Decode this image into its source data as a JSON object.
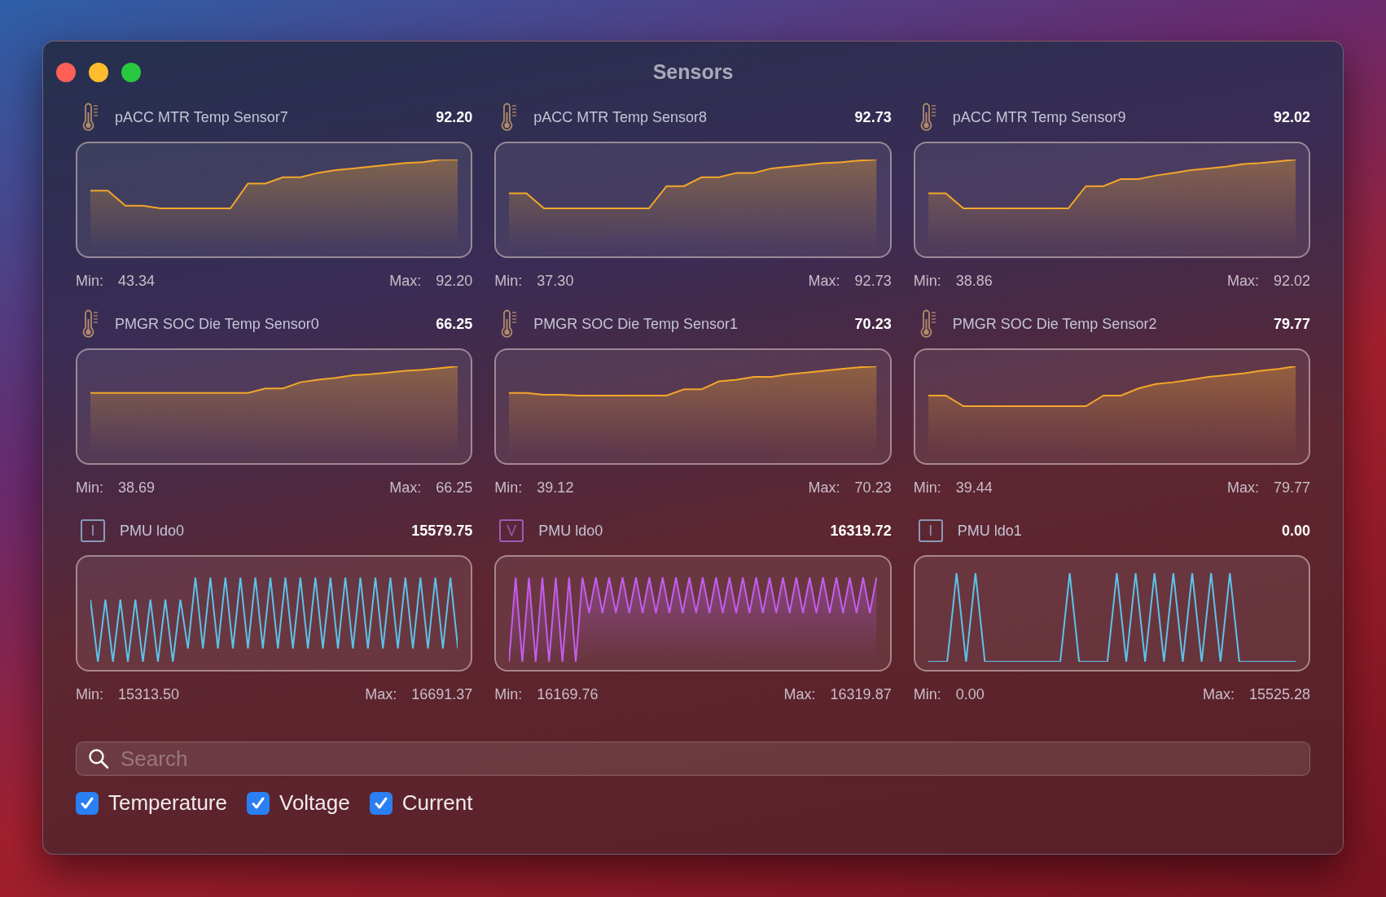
{
  "window": {
    "title": "Sensors"
  },
  "sensors": [
    {
      "kind": "temperature",
      "name": "pACC MTR Temp Sensor7",
      "value": "92.20",
      "min_label": "Min:",
      "min": "43.34",
      "max_label": "Max:",
      "max": "92.20"
    },
    {
      "kind": "temperature",
      "name": "pACC MTR Temp Sensor8",
      "value": "92.73",
      "min_label": "Min:",
      "min": "37.30",
      "max_label": "Max:",
      "max": "92.73"
    },
    {
      "kind": "temperature",
      "name": "pACC MTR Temp Sensor9",
      "value": "92.02",
      "min_label": "Min:",
      "min": "38.86",
      "max_label": "Max:",
      "max": "92.02"
    },
    {
      "kind": "temperature",
      "name": "PMGR SOC Die Temp Sensor0",
      "value": "66.25",
      "min_label": "Min:",
      "min": "38.69",
      "max_label": "Max:",
      "max": "66.25"
    },
    {
      "kind": "temperature",
      "name": "PMGR SOC Die Temp Sensor1",
      "value": "70.23",
      "min_label": "Min:",
      "min": "39.12",
      "max_label": "Max:",
      "max": "70.23"
    },
    {
      "kind": "temperature",
      "name": "PMGR SOC Die Temp Sensor2",
      "value": "79.77",
      "min_label": "Min:",
      "min": "39.44",
      "max_label": "Max:",
      "max": "79.77"
    },
    {
      "kind": "current",
      "badge": "I",
      "name": "PMU ldo0",
      "value": "15579.75",
      "min_label": "Min:",
      "min": "15313.50",
      "max_label": "Max:",
      "max": "16691.37"
    },
    {
      "kind": "voltage",
      "badge": "V",
      "name": "PMU ldo0",
      "value": "16319.72",
      "min_label": "Min:",
      "min": "16169.76",
      "max_label": "Max:",
      "max": "16319.87"
    },
    {
      "kind": "current",
      "badge": "I",
      "name": "PMU ldo1",
      "value": "0.00",
      "min_label": "Min:",
      "min": "0.00",
      "max_label": "Max:",
      "max": "15525.28"
    }
  ],
  "search": {
    "placeholder": "Search"
  },
  "filters": [
    {
      "label": "Temperature",
      "checked": true
    },
    {
      "label": "Voltage",
      "checked": true
    },
    {
      "label": "Current",
      "checked": true
    }
  ]
}
